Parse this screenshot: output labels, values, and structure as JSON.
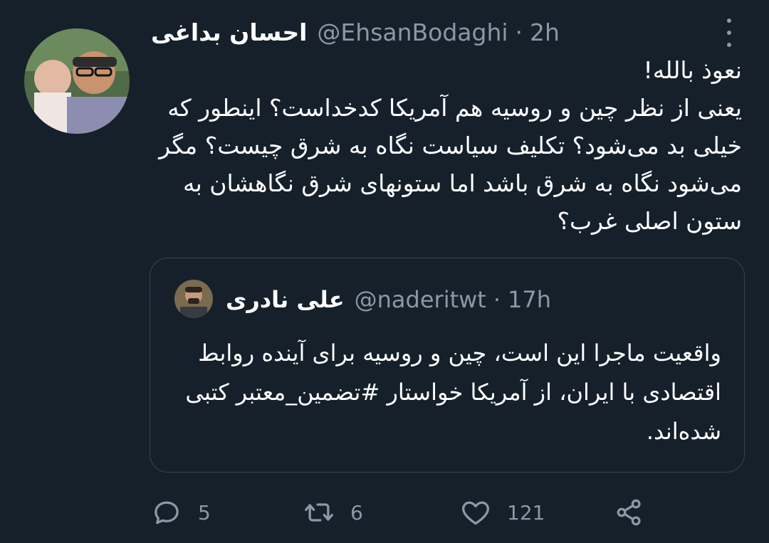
{
  "tweet": {
    "author_name": "احسان بداغی",
    "handle": "@EhsanBodaghi",
    "separator": "·",
    "time": "2h",
    "text": "نعوذ بالله!\nیعنی از نظر چین و روسیه هم آمریکا کدخداست؟ اینطور که خیلی بد می‌شود؟ تکلیف سیاست نگاه به شرق چیست؟ مگر می‌شود نگاه به شرق باشد اما ستونهای شرق نگاهشان به ستون اصلی غرب؟"
  },
  "quoted_tweet": {
    "author_name": "علی نادری",
    "handle": "@naderitwt",
    "separator": "·",
    "time": "17h",
    "text": "واقعیت ماجرا این است، چین و روسیه برای آینده روابط اقتصادی با ایران، از آمریکا خواستار #تضمین_معتبر کتبی شده‌اند."
  },
  "actions": {
    "reply": {
      "icon": "reply-icon",
      "count": "5"
    },
    "retweet": {
      "icon": "retweet-icon",
      "count": "6"
    },
    "like": {
      "icon": "heart-icon",
      "count": "121"
    },
    "share": {
      "icon": "share-icon"
    }
  },
  "colors": {
    "background": "#15202b",
    "text": "#ffffff",
    "secondary_text": "#8b98a5",
    "border": "#38444d"
  }
}
